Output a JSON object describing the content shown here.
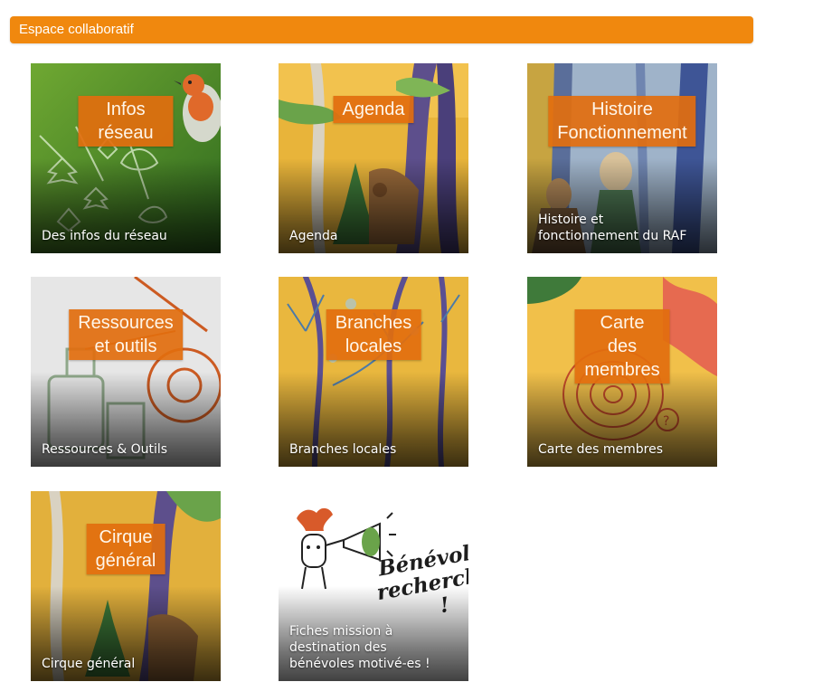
{
  "header": {
    "title": "Espace collaboratif"
  },
  "tiles": [
    {
      "badge": "Infos réseau",
      "caption": "Des infos du réseau",
      "icon": "robin-leaves-illustration"
    },
    {
      "badge": "Agenda",
      "caption": "Agenda",
      "icon": "forest-deer-illustration"
    },
    {
      "badge": "Histoire\nFonctionnement",
      "caption": "Histoire et\nfonctionnement du RAF",
      "icon": "figures-in-forest-illustration"
    },
    {
      "badge": "Ressources\net outils",
      "caption": "Ressources & Outils",
      "icon": "tools-illustration"
    },
    {
      "badge": "Branches\nlocales",
      "caption": "Branches locales",
      "icon": "branches-illustration"
    },
    {
      "badge": "Carte des\nmembres",
      "caption": "Carte des membres",
      "icon": "tree-rings-illustration"
    },
    {
      "badge": "Cirque\ngénéral",
      "caption": "Cirque général",
      "icon": "forest-deer-illustration"
    },
    {
      "badge": "",
      "caption": "Fiches mission à\ndestination des\nbénévoles motivé-es !",
      "icon": "megaphone-character-illustration",
      "artwork_text": "Bénévoles\nrecherchés !"
    }
  ],
  "colors": {
    "accent": "#f0880e",
    "badge": "#e26e0e",
    "overlay": "#000000"
  }
}
